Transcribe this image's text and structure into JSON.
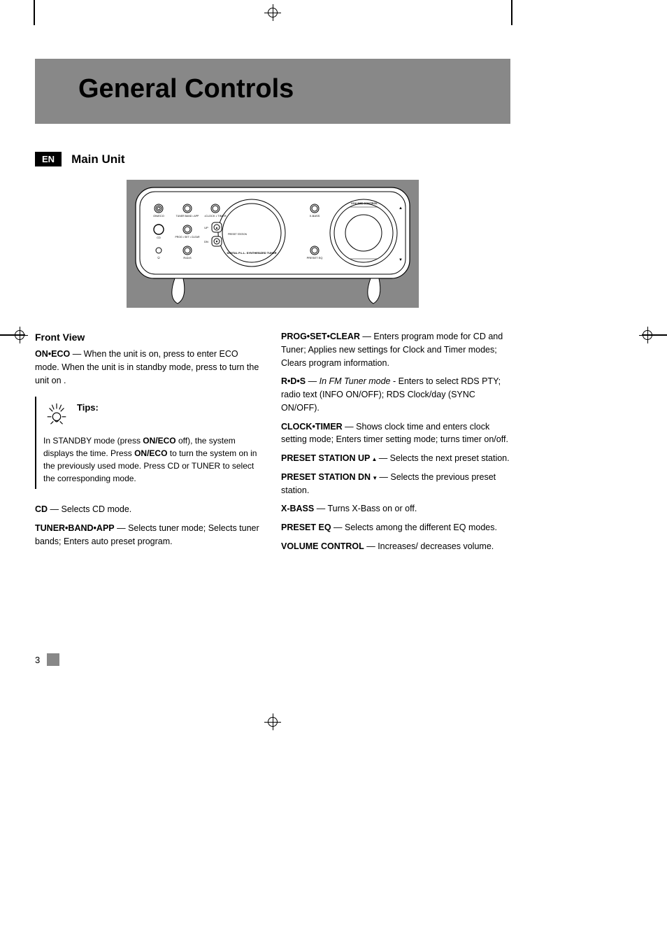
{
  "title": "General Controls",
  "lang_badge": "EN",
  "section": "Main Unit",
  "subhead": "Front View",
  "page_number": "3",
  "device_labels": {
    "volume": "VOLUME CONTROL",
    "on_eco": "ON/ECO",
    "cd": "CD",
    "tuner_band": "TUNER BAND • APP",
    "clock_timer": "•CLOCK • TIMER",
    "prog": "PROG • SET • CLEAR",
    "rds": "R•D•S",
    "up": "UP",
    "dn": "DN",
    "preset_station": "PRESET STATION",
    "xbass": "X-BASS",
    "preset_eq": "PRESET EQ",
    "digital": "DIGITAL P.L.L. SYNTHESIZED TUNER"
  },
  "col1": {
    "onEco": {
      "label": "ON•ECO",
      "text": " — When the unit is on, press to enter ECO mode. When the unit is in standby mode, press to turn the unit on ."
    },
    "tips_label": "Tips:",
    "tips_body": {
      "p1": "In STANDBY mode (press ",
      "s1": "ON/ECO",
      "p2": " off), the system displays the time. Press ",
      "s2": "ON/ECO",
      "p3": " to turn the system on in the previously used mode.  Press CD or TUNER to select the corresponding mode."
    },
    "cd": {
      "label": "CD",
      "text": " — Selects CD mode."
    },
    "tuner": {
      "label": "TUNER•BAND•APP",
      "text": " — Selects tuner mode; Selects tuner bands; Enters auto preset program."
    }
  },
  "col2": {
    "prog": {
      "label": "PROG•SET•CLEAR",
      "text": " — Enters program mode for CD and Tuner; Applies new settings for Clock and Timer modes; Clears program information."
    },
    "rds": {
      "label": "R•D•S",
      "sep": " — ",
      "emph": "In FM Tuner mode",
      "text": " - Enters to select RDS PTY; radio text (INFO ON/OFF); RDS Clock/day (SYNC ON/OFF)."
    },
    "clock": {
      "label": "CLOCK•TIMER",
      "text": " — Shows clock time and enters clock setting mode; Enters timer setting mode; turns timer on/off."
    },
    "presetUp": {
      "label": "PRESET STATION UP",
      "icon": " ▲ ",
      "text": " — Selects the next preset station."
    },
    "presetDn": {
      "label": "PRESET STATION DN",
      "icon": " ▼ ",
      "text": " — Selects the previous preset station."
    },
    "xbass": {
      "label": "X-BASS",
      "text": " — Turns X-Bass on or off."
    },
    "presetEq": {
      "label": "PRESET EQ ",
      "text": " — Selects among the different EQ modes."
    },
    "volume": {
      "label": "VOLUME CONTROL",
      "text": " — Increases/ decreases volume."
    }
  }
}
